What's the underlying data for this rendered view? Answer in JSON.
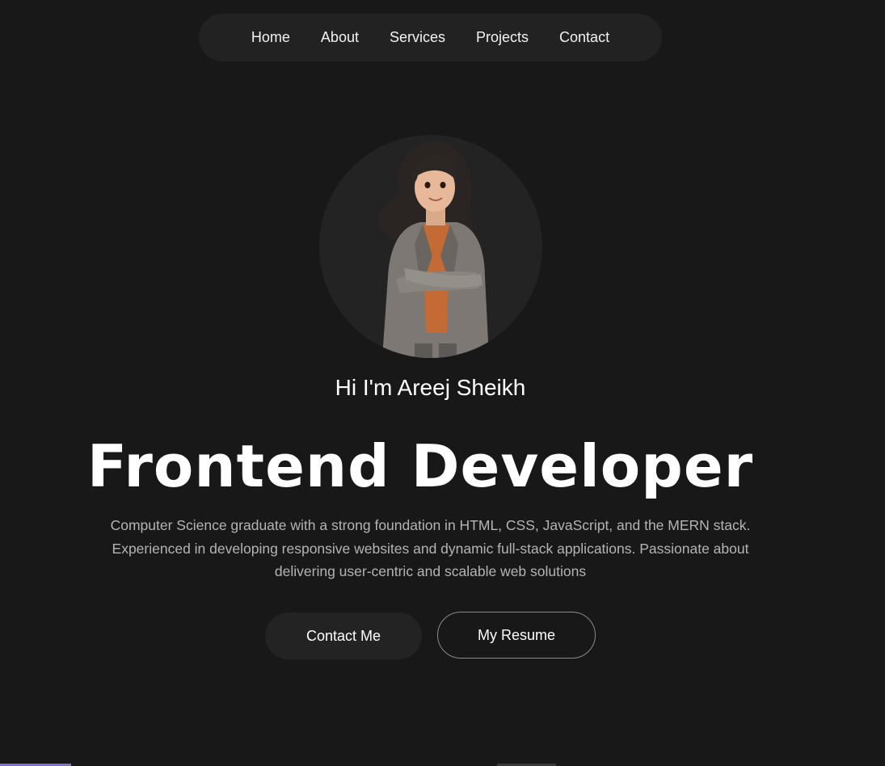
{
  "nav": {
    "items": [
      "Home",
      "About",
      "Services",
      "Projects",
      "Contact"
    ]
  },
  "hero": {
    "greeting": "Hi I'm Areej Sheikh",
    "headline": "Frontend Developer",
    "bio": "Computer Science graduate with a strong foundation in HTML, CSS, JavaScript, and the MERN stack. Experienced in developing responsive websites and dynamic full-stack applications. Passionate about delivering user-centric and scalable web solutions",
    "avatar_icon": "woman-avatar-icon"
  },
  "buttons": {
    "contact_label": "Contact Me",
    "resume_label": "My Resume"
  },
  "colors": {
    "background": "#181818",
    "nav_bg": "#222222",
    "text": "#ffffff",
    "muted_text": "#b4b4b4"
  }
}
